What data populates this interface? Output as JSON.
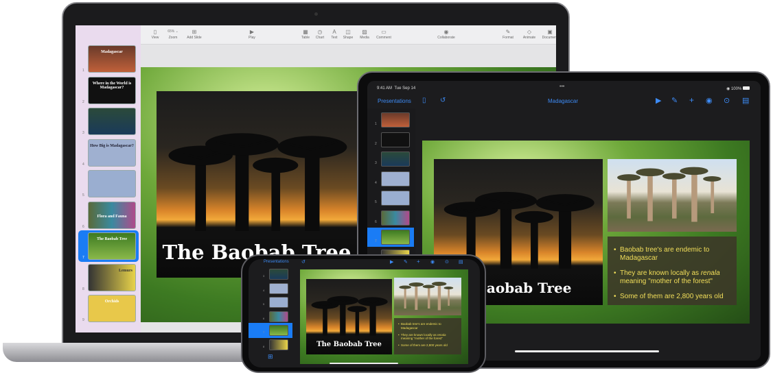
{
  "mac": {
    "toolbar": [
      {
        "label": "View",
        "icon": "sidebar-icon"
      },
      {
        "label": "Zoom",
        "value": "65% ⌄",
        "icon": "zoom-icon"
      },
      {
        "label": "Add Slide",
        "icon": "add-slide-icon"
      },
      {
        "label": "Play",
        "icon": "play-icon"
      },
      {
        "label": "Table",
        "icon": "table-icon"
      },
      {
        "label": "Chart",
        "icon": "chart-icon"
      },
      {
        "label": "Text",
        "icon": "text-icon"
      },
      {
        "label": "Shape",
        "icon": "shape-icon"
      },
      {
        "label": "Media",
        "icon": "media-icon"
      },
      {
        "label": "Comment",
        "icon": "comment-icon"
      },
      {
        "label": "Collaborate",
        "icon": "collaborate-icon"
      },
      {
        "label": "Format",
        "icon": "format-brush-icon"
      },
      {
        "label": "Animate",
        "icon": "animate-icon"
      },
      {
        "label": "Document",
        "icon": "document-icon"
      }
    ],
    "slides": [
      {
        "num": "1",
        "title": "Madagascar"
      },
      {
        "num": "2",
        "title": "Where in the World is Madagascar?"
      },
      {
        "num": "3",
        "title": ""
      },
      {
        "num": "4",
        "title": "How Big is Madagascar?"
      },
      {
        "num": "5",
        "title": ""
      },
      {
        "num": "6",
        "title": "Flora and Fauna"
      },
      {
        "num": "7",
        "title": "The Baobab Tree"
      },
      {
        "num": "8",
        "title": "Lemurs"
      },
      {
        "num": "9",
        "title": "Orchids"
      }
    ],
    "selected_slide": "7",
    "slide_title": "The Baobab Tree"
  },
  "ipad": {
    "status": {
      "time": "9:41 AM",
      "date": "Tue Sep 14",
      "dots": "•••",
      "battery": "100%"
    },
    "toolbar": {
      "back": "Presentations",
      "title": "Madagascar"
    },
    "slide_numbers": [
      "1",
      "2",
      "3",
      "4",
      "5",
      "6",
      "7",
      "8"
    ],
    "slide_title": "Baobab Tree",
    "bullets": [
      {
        "text": "Baobab tree's are endemic to Madagascar"
      },
      {
        "pre": "They are known locally as ",
        "em": "renala",
        "post": " meaning \"mother of the forest\""
      },
      {
        "text": "Some of them are 2,800 years old"
      }
    ]
  },
  "iphone": {
    "toolbar": {
      "back": "Presentations"
    },
    "slide_numbers": [
      "3",
      "4",
      "5",
      "6",
      "7",
      "8"
    ],
    "slide_title": "The Baobab Tree"
  },
  "colors": {
    "accent": "#3d8bf5",
    "selection": "#1a7cf5",
    "bullet_text": "#f3df5a"
  }
}
